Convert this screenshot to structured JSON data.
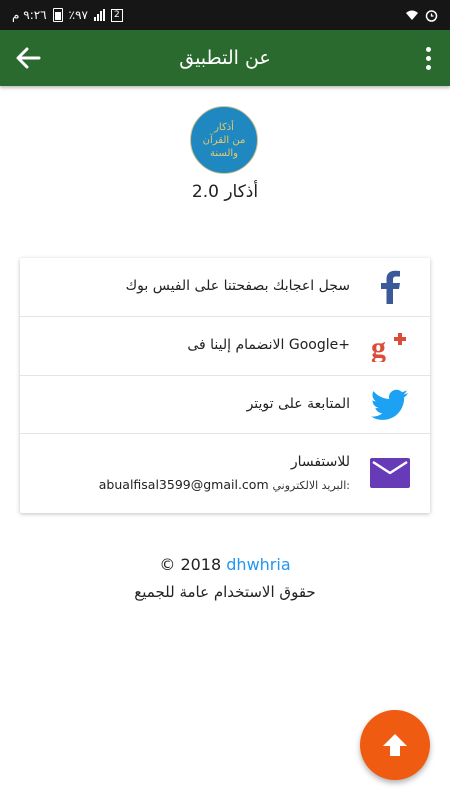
{
  "status_bar": {
    "time": "٩:٢٦ م",
    "battery": "٪٩٧",
    "sim": "2"
  },
  "app_bar": {
    "title": "عن التطبيق",
    "back_icon": "arrow-back-icon",
    "menu_icon": "more-vert-icon"
  },
  "app_info": {
    "logo_lines": [
      "أذكار",
      "من القرآن",
      "والسنة"
    ],
    "name_version": "أذكار 2.0"
  },
  "links": [
    {
      "icon": "facebook-icon",
      "label": "سجل اعجابك بصفحتنا على الفيس بوك",
      "color": "#3b5998"
    },
    {
      "icon": "google-plus-icon",
      "label": "+Google الانضمام إلينا فى",
      "color": "#dd4b39"
    },
    {
      "icon": "twitter-icon",
      "label": "المتابعة على تويتر",
      "color": "#1da1f2"
    },
    {
      "icon": "email-icon",
      "label": "للاستفسار",
      "sub_label": ":البريد الالكتروني",
      "sub_value": "abualfisal3599@gmail.com",
      "color": "#673ab7"
    }
  ],
  "footer": {
    "copyright": "© 2018",
    "link_text": "dhwhria",
    "rights": "حقوق الاستخدام عامة للجميع"
  },
  "fab": {
    "icon": "arrow-up-icon",
    "color": "#ee5b11"
  },
  "theme": {
    "primary": "#2b6a2e",
    "accent": "#2196f3"
  }
}
